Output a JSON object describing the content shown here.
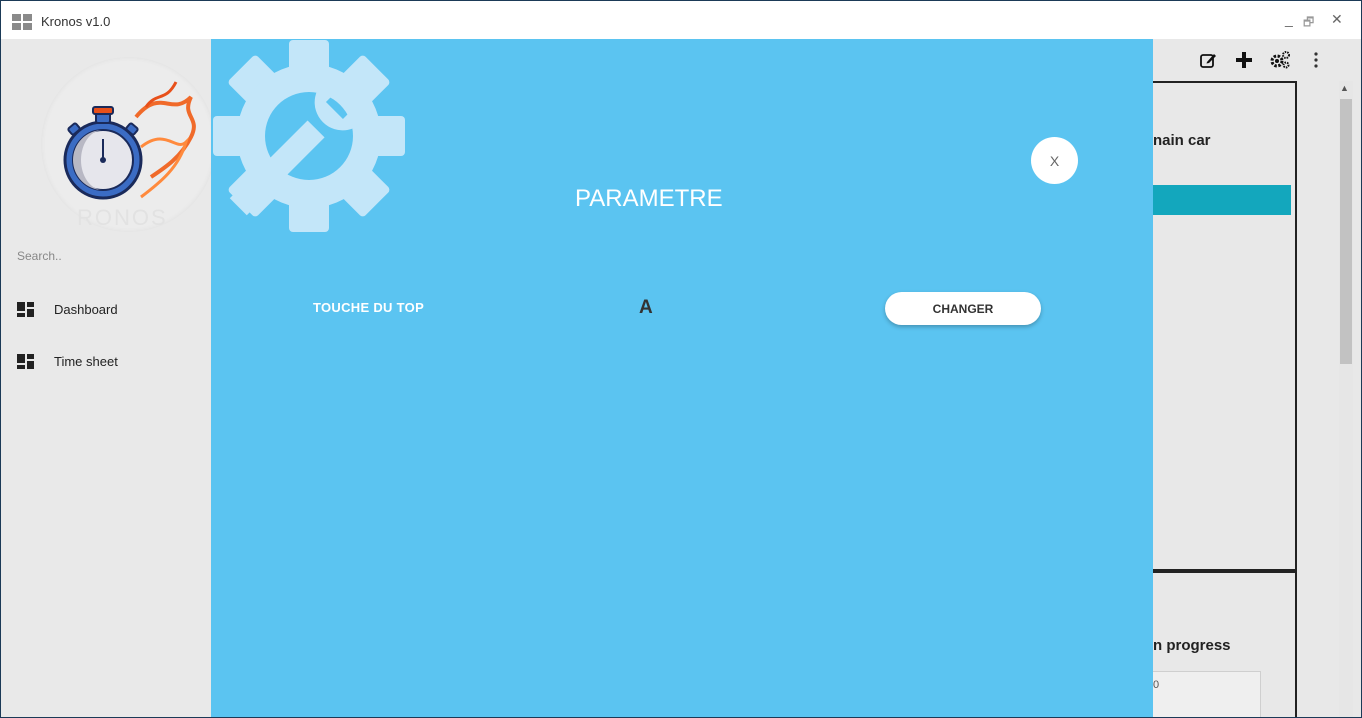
{
  "window": {
    "title": "Kronos v1.0",
    "minimize": "_",
    "restore": "🗗",
    "close": "✕"
  },
  "sidebar": {
    "logo_text": "RONOS",
    "search_placeholder": "Search..",
    "items": [
      {
        "label": "Dashboard",
        "icon": "dashboard-icon"
      },
      {
        "label": "Time sheet",
        "icon": "dashboard-icon"
      }
    ]
  },
  "toolbar": {
    "icons": [
      "edit-icon",
      "plus-icon",
      "gears-icon",
      "more-vert-icon"
    ]
  },
  "background": {
    "panel_title": "nain car",
    "progress_title": "n progress",
    "progress_value": "0"
  },
  "modal": {
    "title": "PARAMETRE",
    "close_label": "X",
    "setting_label": "TOUCHE DU TOP",
    "setting_value": "A",
    "change_button": "CHANGER",
    "colors": {
      "background": "#5bc4f1",
      "gear": "#c3e6f9",
      "accent": "#13a7bd"
    }
  }
}
